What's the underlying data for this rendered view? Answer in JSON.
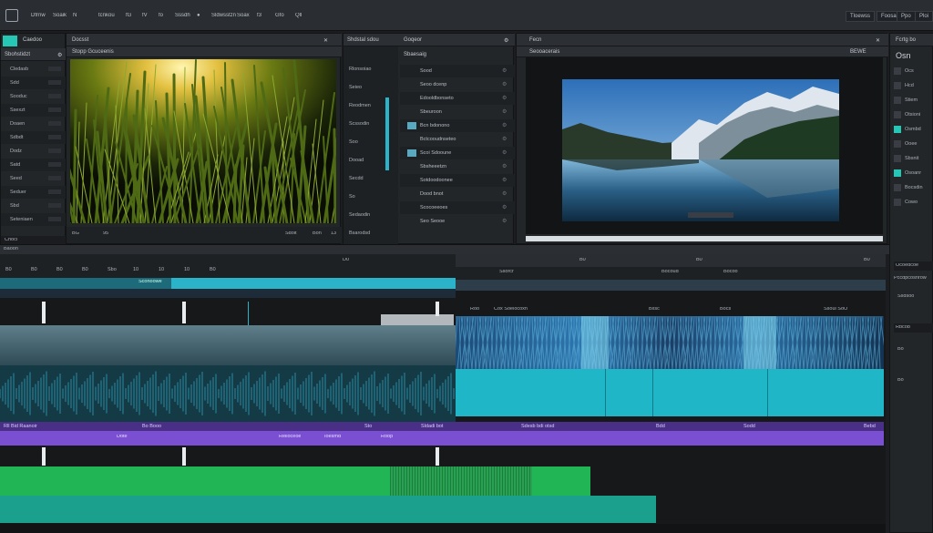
{
  "menubar": {
    "items": [
      "Dfrnw",
      "Soaik",
      "N",
      "tcnkou",
      "fG",
      "fV",
      "fo",
      "Sssdh",
      "●",
      "Sldwsstzn",
      "Soax",
      "f3",
      "Gfo",
      "Qll"
    ],
    "right_buttons": [
      "Tloewss",
      "Foosa",
      "Ppo",
      "Ploi"
    ]
  },
  "left_panel": {
    "tab": "Caedoo",
    "tab2": "Docsst",
    "title": "Sbohstidzt",
    "rows": [
      "Cledasb",
      "Sdd",
      "Sooduc",
      "Ssexzt",
      "Doaen",
      "Sdbdt",
      "Dodz",
      "Satd",
      "Seed",
      "Seduer",
      "Sbd",
      "Seteniaen"
    ],
    "footer": [
      "Chocl",
      "Hilc",
      "Hs"
    ]
  },
  "source_viewer": {
    "title": "Stopp Gcuceenis",
    "footer": [
      "BG",
      "95",
      "Sdoit",
      "Bon",
      "13"
    ]
  },
  "media_list": {
    "tab": "Shdstal sdou",
    "tab2": "Goqeor",
    "header": "Sbaesaig",
    "labels": [
      "Rlonsoiao",
      "Seieo",
      "Reodmen",
      "Scssodin",
      "Soo",
      "Dooad",
      "Secdd",
      "So",
      "Sedaodin",
      "Bsarodsd"
    ],
    "items": [
      "Sood",
      "Seoo dcenp",
      "Edooldbonseto",
      "Sbeuroon",
      "Bcn bdonono",
      "Bctcooudnseteo",
      "Scoi Sdooune",
      "Sbsheeetzn",
      "Sotdoodoonee",
      "Dood bnot",
      "Scocoeeoes",
      "Seo Seooe"
    ]
  },
  "program_viewer": {
    "tab": "Fecn",
    "title": "Seooacerais",
    "badge": "BEWE"
  },
  "inspector": {
    "tab": "Fcrtg bo",
    "title": "Osn",
    "rows": [
      "Ocs",
      "Hcd",
      "Stiem",
      "Otsioni",
      "Osmbd",
      "Ooee",
      "Sbsnit",
      "Osoanr",
      "Bocsdin",
      "Cowo"
    ],
    "section2_title": "Ocoedcoe",
    "section2_rows": [
      "Pccdpcosnrow",
      "Ssdsoo"
    ],
    "section3_title": "Rbcob",
    "section3_rows": [
      "Bo",
      "Bo"
    ]
  },
  "timeline": {
    "track_label": "Baoon",
    "ruler_left": [
      "B0",
      "B0",
      "B0",
      "B0",
      "Sbo",
      "10",
      "10",
      "10",
      "B0"
    ],
    "ruler_center": "D0",
    "ruler_right_center": "B0",
    "ruler_right": [
      "B0",
      "B0",
      "B0"
    ],
    "section_labels": [
      "Ssorcr",
      "Bocoud",
      "Bocoo"
    ],
    "clip_labels_a": [
      "Roo",
      "Cox Soeiocoxn",
      "Bxsc",
      "Bocs",
      "Ssoui SoO"
    ],
    "clip_labels_top": [
      "Sconoowe"
    ],
    "purple_top": [
      "Rll Bid Raanoir",
      "Bo Booo",
      "Sto",
      "Sldadi bot",
      "Sdesb bdi otsd",
      "Bdd",
      "Sodd",
      "Bebd"
    ],
    "purple_bottom": [
      "Dote",
      "Reiloceoe",
      "Ioesmd",
      "Roop"
    ]
  },
  "colors": {
    "teal": "#2ab3c9",
    "purple": "#7a4fd1",
    "green": "#22b556",
    "accent": "#27c7b5"
  }
}
